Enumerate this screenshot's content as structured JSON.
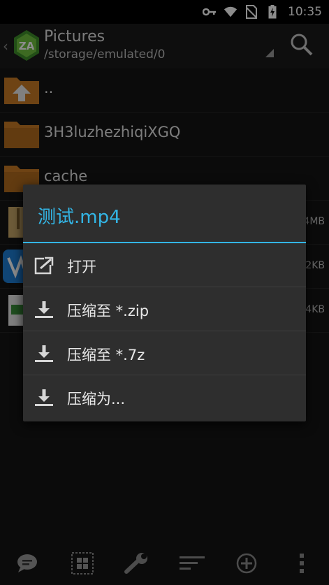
{
  "status_bar": {
    "time": "10:35",
    "icons": [
      "key-icon",
      "wifi-icon",
      "no-sim-icon",
      "battery-charging-icon"
    ]
  },
  "action_bar": {
    "title": "Pictures",
    "path": "/storage/emulated/0"
  },
  "files": [
    {
      "name": "..",
      "icon": "folder-up-icon",
      "size": ""
    },
    {
      "name": "3H3luzhezhiqiXGQ",
      "icon": "folder-icon",
      "size": ""
    },
    {
      "name": "cache",
      "icon": "folder-icon",
      "size": ""
    },
    {
      "name": "",
      "icon": "zip-file-icon",
      "size": "4MB"
    },
    {
      "name": "",
      "icon": "app-file-icon",
      "size": "2KB"
    },
    {
      "name": "",
      "icon": "apk-file-icon",
      "size": "4KB"
    }
  ],
  "dialog": {
    "title": "测试.mp4",
    "items": [
      {
        "label": "打开",
        "icon": "open-external-icon"
      },
      {
        "label": "压缩至 *.zip",
        "icon": "download-icon"
      },
      {
        "label": "压缩至 *.7z",
        "icon": "download-icon"
      },
      {
        "label": "压缩为...",
        "icon": "download-icon"
      }
    ]
  },
  "colors": {
    "accent": "#33b5e5",
    "folder": "#c87b26",
    "dialog_bg": "#2e2e2e"
  },
  "bottom_toolbar": [
    "chat-icon",
    "select-grid-icon",
    "wrench-icon",
    "sort-icon",
    "add-circle-icon",
    "overflow-menu-icon"
  ]
}
